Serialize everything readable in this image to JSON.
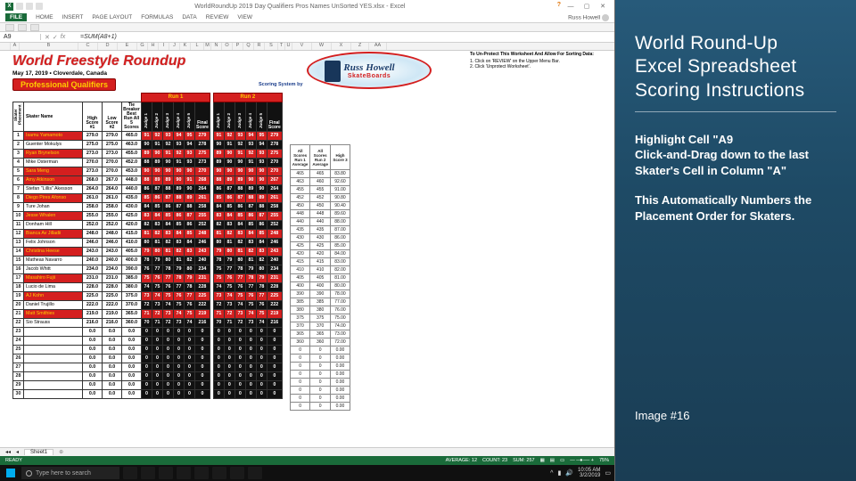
{
  "window_title": "WorldRoundUp 2019 Day Qualifiers Pros Names UnSorted YES.xlsx - Excel",
  "ribbon": {
    "file": "FILE",
    "tabs": [
      "HOME",
      "INSERT",
      "PAGE LAYOUT",
      "FORMULAS",
      "DATA",
      "REVIEW",
      "VIEW"
    ],
    "signin": "Russ Howell"
  },
  "namebox": "A9",
  "formula": "=SUM(A8+1)",
  "title": {
    "big": "World Freestyle Roundup",
    "date": "May 17, 2019 • Cloverdale, Canada",
    "pro": "Professional Qualifiers"
  },
  "logo": {
    "line1": "Russ Howell",
    "line2": "SkateBoards"
  },
  "scoresys": "Scoring System by",
  "protect": {
    "t": "To Un-Protect This Worksheet And Allow For Sorting Data:",
    "l1": "1. Click on 'REVIEW' on the Upper Menu Bar.",
    "l2": "2. Click 'Unprotect Worksheet'."
  },
  "run_headers": [
    "Run 1",
    "Run 2"
  ],
  "col_headers": {
    "place": "Skater\nPlacement",
    "name": "Skater Name",
    "high": "High\nScore #1",
    "low": "Low\nScore #2",
    "tb": "Tie\nBreaker\nBest Run\nAll 5\nScores",
    "jg": [
      "Judge 1",
      "Judge 2",
      "Judge 3",
      "Judge 4",
      "Judge 5",
      "Final\nScore"
    ],
    "side": [
      "All Scores\nRun 1\nAverage",
      "All Scores\nRun 2\nAverage",
      "High\nScore 3"
    ]
  },
  "rows": [
    {
      "p": 1,
      "n": "Isamu Yamamoto",
      "hi": "279.0",
      "lo": "279.0",
      "tb": "465.0",
      "r1": [
        "91",
        "92",
        "93",
        "94",
        "95",
        "279"
      ],
      "r2": [
        "91",
        "92",
        "93",
        "94",
        "95",
        "279"
      ],
      "s": [
        "465",
        "465",
        "83.80"
      ],
      "hl": "red"
    },
    {
      "p": 2,
      "n": "Guenter Mokulys",
      "hi": "275.0",
      "lo": "275.0",
      "tb": "463.0",
      "r1": [
        "90",
        "91",
        "92",
        "93",
        "94",
        "278"
      ],
      "r2": [
        "90",
        "91",
        "92",
        "93",
        "94",
        "278"
      ],
      "s": [
        "463",
        "460",
        "92.60"
      ],
      "hl": "white"
    },
    {
      "p": 3,
      "n": "Ryan Brynelson",
      "hi": "273.0",
      "lo": "273.0",
      "tb": "455.0",
      "r1": [
        "89",
        "90",
        "91",
        "92",
        "93",
        "275"
      ],
      "r2": [
        "89",
        "90",
        "91",
        "92",
        "93",
        "275"
      ],
      "s": [
        "455",
        "455",
        "91.00"
      ],
      "hl": "red"
    },
    {
      "p": 4,
      "n": "Mike Osterman",
      "hi": "270.0",
      "lo": "270.0",
      "tb": "452.0",
      "r1": [
        "88",
        "89",
        "90",
        "91",
        "93",
        "273"
      ],
      "r2": [
        "89",
        "90",
        "90",
        "91",
        "93",
        "270"
      ],
      "s": [
        "452",
        "452",
        "90.80"
      ],
      "hl": "white"
    },
    {
      "p": 5,
      "n": "Sara Meng",
      "hi": "273.0",
      "lo": "270.0",
      "tb": "453.0",
      "r1": [
        "90",
        "90",
        "90",
        "90",
        "90",
        "270"
      ],
      "r2": [
        "90",
        "90",
        "90",
        "90",
        "90",
        "270"
      ],
      "s": [
        "450",
        "450",
        "90.40"
      ],
      "hl": "red"
    },
    {
      "p": 6,
      "n": "Amy Atkinson",
      "hi": "268.0",
      "lo": "267.0",
      "tb": "448.0",
      "r1": [
        "88",
        "89",
        "89",
        "90",
        "91",
        "268"
      ],
      "r2": [
        "88",
        "89",
        "89",
        "90",
        "90",
        "267"
      ],
      "s": [
        "448",
        "448",
        "89.60"
      ],
      "hl": "red"
    },
    {
      "p": 7,
      "n": "Stefan \"Lillis\" Akesson",
      "hi": "264.0",
      "lo": "264.0",
      "tb": "440.0",
      "r1": [
        "86",
        "87",
        "88",
        "89",
        "90",
        "264"
      ],
      "r2": [
        "86",
        "87",
        "88",
        "89",
        "90",
        "264"
      ],
      "s": [
        "440",
        "440",
        "88.00"
      ],
      "hl": "white"
    },
    {
      "p": 8,
      "n": "Diego Pires Afonso",
      "hi": "261.0",
      "lo": "261.0",
      "tb": "435.0",
      "r1": [
        "85",
        "86",
        "87",
        "88",
        "89",
        "261"
      ],
      "r2": [
        "85",
        "86",
        "87",
        "88",
        "89",
        "261"
      ],
      "s": [
        "435",
        "435",
        "87.00"
      ],
      "hl": "red"
    },
    {
      "p": 9,
      "n": "Ture Johan",
      "hi": "258.0",
      "lo": "258.0",
      "tb": "430.0",
      "r1": [
        "84",
        "85",
        "86",
        "87",
        "88",
        "258"
      ],
      "r2": [
        "84",
        "85",
        "86",
        "87",
        "88",
        "258"
      ],
      "s": [
        "430",
        "430",
        "86.00"
      ],
      "hl": "white"
    },
    {
      "p": 10,
      "n": "Jesse Whalen",
      "hi": "255.0",
      "lo": "255.0",
      "tb": "425.0",
      "r1": [
        "83",
        "84",
        "85",
        "86",
        "87",
        "255"
      ],
      "r2": [
        "83",
        "84",
        "85",
        "86",
        "87",
        "255"
      ],
      "s": [
        "425",
        "425",
        "85.00"
      ],
      "hl": "red"
    },
    {
      "p": 11,
      "n": "Donham Hill",
      "hi": "252.0",
      "lo": "252.0",
      "tb": "420.0",
      "r1": [
        "82",
        "83",
        "84",
        "85",
        "86",
        "252"
      ],
      "r2": [
        "82",
        "83",
        "84",
        "85",
        "86",
        "252"
      ],
      "s": [
        "420",
        "420",
        "84.00"
      ],
      "hl": "white"
    },
    {
      "p": 12,
      "n": "Bianca Av Jilladii",
      "hi": "248.0",
      "lo": "248.0",
      "tb": "415.0",
      "r1": [
        "81",
        "82",
        "83",
        "84",
        "85",
        "248"
      ],
      "r2": [
        "81",
        "82",
        "83",
        "84",
        "85",
        "248"
      ],
      "s": [
        "415",
        "415",
        "83.00"
      ],
      "hl": "red"
    },
    {
      "p": 13,
      "n": "Felix Johnson",
      "hi": "246.0",
      "lo": "246.0",
      "tb": "410.0",
      "r1": [
        "80",
        "81",
        "82",
        "83",
        "84",
        "246"
      ],
      "r2": [
        "80",
        "81",
        "82",
        "83",
        "84",
        "246"
      ],
      "s": [
        "410",
        "410",
        "82.00"
      ],
      "hl": "white"
    },
    {
      "p": 14,
      "n": "Christina Heese",
      "hi": "243.0",
      "lo": "243.0",
      "tb": "405.0",
      "r1": [
        "79",
        "80",
        "81",
        "82",
        "83",
        "243"
      ],
      "r2": [
        "79",
        "80",
        "81",
        "82",
        "83",
        "243"
      ],
      "s": [
        "405",
        "405",
        "81.00"
      ],
      "hl": "red"
    },
    {
      "p": 15,
      "n": "Matheas Navarro",
      "hi": "240.0",
      "lo": "240.0",
      "tb": "400.0",
      "r1": [
        "78",
        "79",
        "80",
        "81",
        "82",
        "240"
      ],
      "r2": [
        "78",
        "79",
        "80",
        "81",
        "82",
        "240"
      ],
      "s": [
        "400",
        "400",
        "80.00"
      ],
      "hl": "white"
    },
    {
      "p": 16,
      "n": "Jacob Whitt",
      "hi": "234.0",
      "lo": "234.0",
      "tb": "390.0",
      "r1": [
        "76",
        "77",
        "78",
        "79",
        "80",
        "234"
      ],
      "r2": [
        "75",
        "77",
        "78",
        "79",
        "80",
        "234"
      ],
      "s": [
        "390",
        "390",
        "78.00"
      ],
      "hl": "white"
    },
    {
      "p": 17,
      "n": "Masahiro Fujii",
      "hi": "231.0",
      "lo": "231.0",
      "tb": "385.0",
      "r1": [
        "75",
        "76",
        "77",
        "78",
        "79",
        "231"
      ],
      "r2": [
        "75",
        "76",
        "77",
        "78",
        "79",
        "231"
      ],
      "s": [
        "385",
        "385",
        "77.00"
      ],
      "hl": "red"
    },
    {
      "p": 18,
      "n": "Lucio de Lima",
      "hi": "228.0",
      "lo": "228.0",
      "tb": "380.0",
      "r1": [
        "74",
        "75",
        "76",
        "77",
        "78",
        "228"
      ],
      "r2": [
        "74",
        "75",
        "76",
        "77",
        "78",
        "228"
      ],
      "s": [
        "380",
        "380",
        "76.00"
      ],
      "hl": "white"
    },
    {
      "p": 19,
      "n": "AJ Kohn",
      "hi": "225.0",
      "lo": "225.0",
      "tb": "375.0",
      "r1": [
        "73",
        "74",
        "75",
        "76",
        "77",
        "225"
      ],
      "r2": [
        "73",
        "74",
        "75",
        "76",
        "77",
        "225"
      ],
      "s": [
        "375",
        "375",
        "75.00"
      ],
      "hl": "red"
    },
    {
      "p": 20,
      "n": "Daniel Trujillo",
      "hi": "222.0",
      "lo": "222.0",
      "tb": "370.0",
      "r1": [
        "72",
        "73",
        "74",
        "75",
        "76",
        "222"
      ],
      "r2": [
        "72",
        "73",
        "74",
        "75",
        "76",
        "222"
      ],
      "s": [
        "370",
        "370",
        "74.00"
      ],
      "hl": "white"
    },
    {
      "p": 21,
      "n": "Matt Smithies",
      "hi": "219.0",
      "lo": "219.0",
      "tb": "365.0",
      "r1": [
        "71",
        "72",
        "73",
        "74",
        "75",
        "219"
      ],
      "r2": [
        "71",
        "72",
        "73",
        "74",
        "75",
        "219"
      ],
      "s": [
        "365",
        "365",
        "73.00"
      ],
      "hl": "red"
    },
    {
      "p": 22,
      "n": "Sio Strauss",
      "hi": "216.0",
      "lo": "216.0",
      "tb": "360.0",
      "r1": [
        "70",
        "71",
        "72",
        "73",
        "74",
        "216"
      ],
      "r2": [
        "70",
        "71",
        "72",
        "73",
        "74",
        "216"
      ],
      "s": [
        "360",
        "360",
        "72.00"
      ],
      "hl": "white"
    },
    {
      "p": 23,
      "n": "",
      "hi": "0.0",
      "lo": "0.0",
      "tb": "0.0",
      "r1": [
        "0",
        "0",
        "0",
        "0",
        "0",
        "0"
      ],
      "r2": [
        "0",
        "0",
        "0",
        "0",
        "0",
        "0"
      ],
      "s": [
        "0",
        "0",
        "0.00"
      ],
      "hl": "white"
    },
    {
      "p": 24,
      "n": "",
      "hi": "0.0",
      "lo": "0.0",
      "tb": "0.0",
      "r1": [
        "0",
        "0",
        "0",
        "0",
        "0",
        "0"
      ],
      "r2": [
        "0",
        "0",
        "0",
        "0",
        "0",
        "0"
      ],
      "s": [
        "0",
        "0",
        "0.00"
      ],
      "hl": "white"
    },
    {
      "p": 25,
      "n": "",
      "hi": "0.0",
      "lo": "0.0",
      "tb": "0.0",
      "r1": [
        "0",
        "0",
        "0",
        "0",
        "0",
        "0"
      ],
      "r2": [
        "0",
        "0",
        "0",
        "0",
        "0",
        "0"
      ],
      "s": [
        "0",
        "0",
        "0.00"
      ],
      "hl": "white"
    },
    {
      "p": 26,
      "n": "",
      "hi": "0.0",
      "lo": "0.0",
      "tb": "0.0",
      "r1": [
        "0",
        "0",
        "0",
        "0",
        "0",
        "0"
      ],
      "r2": [
        "0",
        "0",
        "0",
        "0",
        "0",
        "0"
      ],
      "s": [
        "0",
        "0",
        "0.00"
      ],
      "hl": "white"
    },
    {
      "p": 27,
      "n": "",
      "hi": "0.0",
      "lo": "0.0",
      "tb": "0.0",
      "r1": [
        "0",
        "0",
        "0",
        "0",
        "0",
        "0"
      ],
      "r2": [
        "0",
        "0",
        "0",
        "0",
        "0",
        "0"
      ],
      "s": [
        "0",
        "0",
        "0.00"
      ],
      "hl": "white"
    },
    {
      "p": 28,
      "n": "",
      "hi": "0.0",
      "lo": "0.0",
      "tb": "0.0",
      "r1": [
        "0",
        "0",
        "0",
        "0",
        "0",
        "0"
      ],
      "r2": [
        "0",
        "0",
        "0",
        "0",
        "0",
        "0"
      ],
      "s": [
        "0",
        "0",
        "0.00"
      ],
      "hl": "white"
    },
    {
      "p": 29,
      "n": "",
      "hi": "0.0",
      "lo": "0.0",
      "tb": "0.0",
      "r1": [
        "0",
        "0",
        "0",
        "0",
        "0",
        "0"
      ],
      "r2": [
        "0",
        "0",
        "0",
        "0",
        "0",
        "0"
      ],
      "s": [
        "0",
        "0",
        "0.00"
      ],
      "hl": "white"
    },
    {
      "p": 30,
      "n": "",
      "hi": "0.0",
      "lo": "0.0",
      "tb": "0.0",
      "r1": [
        "0",
        "0",
        "0",
        "0",
        "0",
        "0"
      ],
      "r2": [
        "0",
        "0",
        "0",
        "0",
        "0",
        "0"
      ],
      "s": [
        "0",
        "0",
        "0.00"
      ],
      "hl": "white"
    }
  ],
  "sheet_tab": "Sheet1",
  "statusbar": {
    "ready": "READY",
    "avg": "AVERAGE: 12",
    "cnt": "COUNT: 23",
    "sum": "SUM: 257",
    "zoom": "75%"
  },
  "taskbar": {
    "search": "Type here to search",
    "time": "10:05 AM",
    "date": "3/2/2019"
  },
  "panel": {
    "title_l1": "World Round-Up",
    "title_l2": "Excel Spreadsheet",
    "title_l3": "Scoring Instructions",
    "p1": "Highlight Cell \"A9",
    "p2": "Click-and-Drag down to the last Skater's Cell in Column \"A\"",
    "p3": "This Automatically Numbers the Placement Order for Skaters.",
    "img": "Image #16"
  }
}
